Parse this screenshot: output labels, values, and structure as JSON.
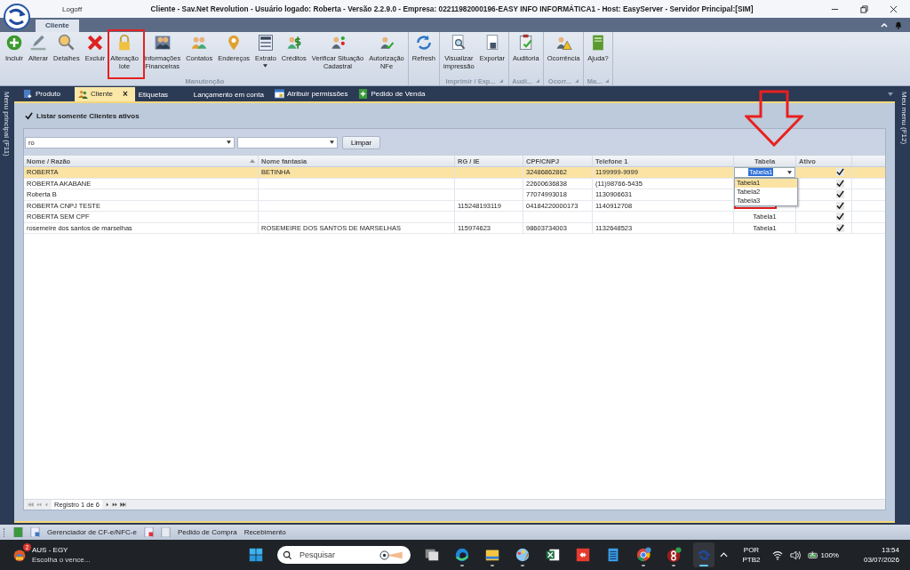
{
  "window": {
    "logoff": "Logoff",
    "title": "Cliente - Sav.Net Revolution - Usuário logado: Roberta - Versão 2.2.9.0 - Empresa: 02211982000196-EASY INFO INFORMÁTICA1 - Host: EasyServer - Servidor Principal:[SIM]"
  },
  "ribbon": {
    "tab": {
      "label": "Cliente",
      "selected": true
    },
    "groups": [
      {
        "label": "Manutenção",
        "buttons": [
          {
            "label": "Incluir",
            "dropdown": false
          },
          {
            "label": "Alterar",
            "dropdown": false
          },
          {
            "label": "Detalhes",
            "dropdown": false
          },
          {
            "label": "Excluir",
            "dropdown": false
          },
          {
            "label": "Alteração\nlote",
            "dropdown": false
          },
          {
            "label": "Informações\nFinanceiras",
            "dropdown": false
          },
          {
            "label": "Contatos",
            "dropdown": false
          },
          {
            "label": "Endereços",
            "dropdown": false
          },
          {
            "label": "Extrato",
            "dropdown": true
          },
          {
            "label": "Créditos",
            "dropdown": false
          },
          {
            "label": "Verificar Situação\nCadastral",
            "dropdown": false
          },
          {
            "label": "Autorização\nNFe",
            "dropdown": false
          }
        ]
      },
      {
        "buttons": [
          {
            "label": "Refresh",
            "dropdown": false
          }
        ]
      },
      {
        "label": "Imprimir / Exp...",
        "buttons": [
          {
            "label": "Visualizar\nimpressão",
            "dropdown": false
          },
          {
            "label": "Exportar",
            "dropdown": false
          }
        ]
      },
      {
        "label": "Audi...",
        "buttons": [
          {
            "label": "Auditoria",
            "dropdown": false
          }
        ]
      },
      {
        "label": "Ocorr...",
        "buttons": [
          {
            "label": "Ocorrência",
            "dropdown": false
          }
        ]
      },
      {
        "label": "Ma...",
        "buttons": [
          {
            "label": "Ajuda?",
            "dropdown": false
          }
        ]
      }
    ]
  },
  "side_menus": {
    "left": "Menu principal (F11)",
    "right": "Meu menu (F12)"
  },
  "doc_tabs": [
    {
      "label": "Produto",
      "selected": false
    },
    {
      "label": "Cliente",
      "selected": true,
      "close": "×"
    },
    {
      "label": "Etiquetas",
      "selected": false
    },
    {
      "label": "Lançamento em conta",
      "selected": false
    },
    {
      "label": "Atribuir permissões",
      "selected": false
    },
    {
      "label": "Pedido de Venda",
      "selected": false
    }
  ],
  "filter": {
    "only_active": {
      "label": "Listar somente Clientes ativos",
      "checked": true
    },
    "search": {
      "value": "ro"
    },
    "clear_button": "Limpar"
  },
  "table": {
    "columns": [
      {
        "label": "Nome / Razão",
        "sorted": true
      },
      {
        "label": "Nome fantasia",
        "sorted": false
      },
      {
        "label": "RG / IE",
        "sorted": false
      },
      {
        "label": "CPF/CNPJ",
        "sorted": false
      },
      {
        "label": "Telefone 1",
        "sorted": false
      },
      {
        "label": "Tabela",
        "sorted": false
      },
      {
        "label": "Ativo",
        "sorted": false
      }
    ],
    "rows": [
      {
        "selected": true,
        "nome": "ROBERTA",
        "fantasia": "BETINHA",
        "cpf_cnpj": "32486862862",
        "telefone": "1199999-9999",
        "ativo": true
      },
      {
        "selected": false,
        "nome": "ROBERTA AKABANE",
        "cpf_cnpj": "22600636838",
        "telefone": "(11)98766-5435",
        "ativo": true
      },
      {
        "selected": false,
        "nome": "Roberta B",
        "cpf_cnpj": "77074993018",
        "telefone": "1130906631",
        "ativo": true
      },
      {
        "selected": false,
        "nome": "ROBERTA CNPJ TESTE",
        "rg_ie": "115248193119",
        "cpf_cnpj": "04184220000173",
        "telefone": "1140912708",
        "ativo": true
      },
      {
        "selected": false,
        "nome": "ROBERTA SEM CPF",
        "tabela": "Tabela1",
        "ativo": true
      },
      {
        "selected": false,
        "nome": "rosemeire dos santos de marselhas",
        "fantasia": "ROSEMEIRE DOS SANTOS DE MARSELHAS",
        "rg_ie": "115974623",
        "cpf_cnpj": "98603734003",
        "telefone": "1132648523",
        "tabela": "Tabela1",
        "ativo": true
      }
    ],
    "editor": {
      "value": "Tabela1",
      "options": [
        {
          "label": "Tabela1",
          "selected": true
        },
        {
          "label": "Tabela2",
          "selected": false
        },
        {
          "label": "Tabela3",
          "selected": false
        }
      ]
    }
  },
  "pager": {
    "text": "Registro 1 de 6"
  },
  "bottom_toolbar": [
    {
      "kind": "icon"
    },
    {
      "kind": "icon"
    },
    {
      "kind": "text",
      "label": "Gerenciador de CF-e/NFC-e"
    },
    {
      "kind": "icon"
    },
    {
      "kind": "icon"
    },
    {
      "kind": "text",
      "label": "Pedido de Compra"
    },
    {
      "kind": "text",
      "label": "Recebimento"
    }
  ],
  "taskbar": {
    "widget": {
      "title": "AUS - EGY",
      "subtitle": "Escolha o vence...",
      "badge": "2"
    },
    "search": {
      "placeholder": "Pesquisar"
    },
    "apps": [
      {
        "running": false,
        "active": false
      },
      {
        "running": true,
        "active": false
      },
      {
        "running": true,
        "active": false
      },
      {
        "running": true,
        "active": false
      },
      {
        "running": false,
        "active": false
      },
      {
        "running": false,
        "active": false
      },
      {
        "running": false,
        "active": false
      },
      {
        "running": true,
        "active": false
      },
      {
        "running": true,
        "active": false
      },
      {
        "running": true,
        "active": true
      }
    ],
    "tray": {
      "language": "POR",
      "layout": "PTB2",
      "battery": "100%",
      "time": "13:54",
      "date": "03/07/2026"
    }
  }
}
